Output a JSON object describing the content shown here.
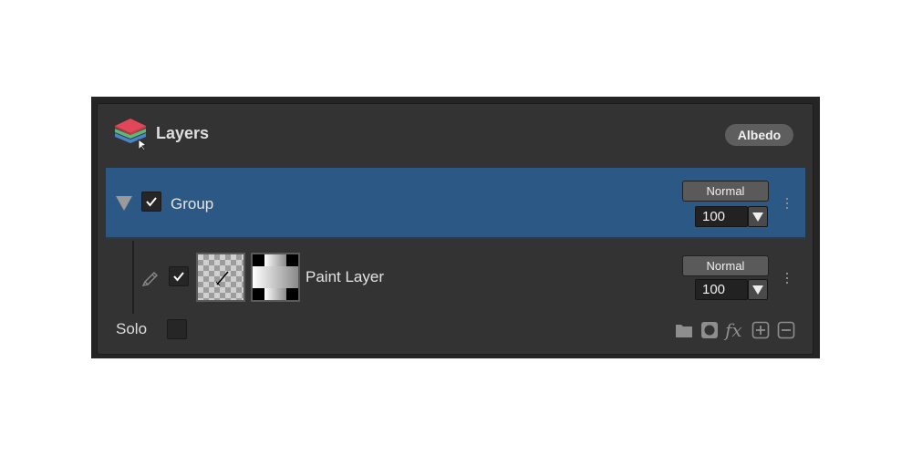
{
  "panel": {
    "title": "Layers",
    "badge": "Albedo"
  },
  "group_layer": {
    "name": "Group",
    "visible": true,
    "blend_mode": "Normal",
    "opacity": "100"
  },
  "paint_layer": {
    "name": "Paint Layer",
    "visible": true,
    "blend_mode": "Normal",
    "opacity": "100"
  },
  "footer": {
    "solo_label": "Solo",
    "solo_checked": false,
    "icons": [
      "folder-icon",
      "mask-icon",
      "fx-icon",
      "add-icon",
      "remove-icon"
    ],
    "fx_text": "fx"
  },
  "colors": {
    "selected_row": "#2b5884",
    "panel_bg": "#333333",
    "logo_top": "#e0485a",
    "logo_middle": "#5cb87a",
    "logo_bottom": "#4a84c8"
  }
}
